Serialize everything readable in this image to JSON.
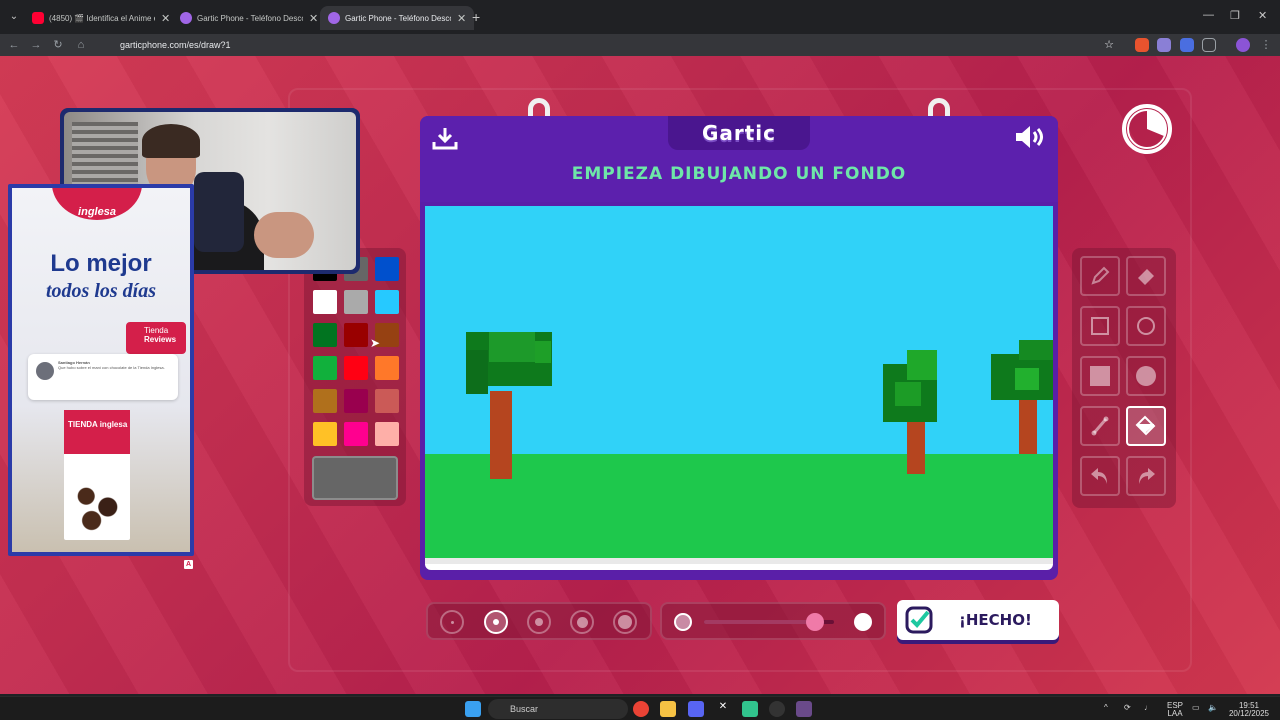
{
  "browser": {
    "tabs": [
      {
        "label": "(4850) 🎬 Identifica el Anime e",
        "favicon": "youtube-icon"
      },
      {
        "label": "Gartic Phone - Teléfono Desco",
        "favicon": "gartic-icon"
      },
      {
        "label": "Gartic Phone - Teléfono Desco",
        "favicon": "gartic-icon",
        "active": true
      }
    ],
    "url": "garticphone.com/es/draw?1"
  },
  "game": {
    "logo": "Gartic",
    "instruction": "EMPIEZA DIBUJANDO UN FONDO",
    "done_label": "¡HECHO!",
    "palette": [
      "#000000",
      "#666666",
      "#0050cd",
      "#ffffff",
      "#aaaaaa",
      "#26c9ff",
      "#017420",
      "#990000",
      "#964112",
      "#11b03c",
      "#ff0013",
      "#ff7829",
      "#b0701c",
      "#99004e",
      "#cb5a57",
      "#ffc126",
      "#ff008f",
      "#feafa8"
    ],
    "current_color": "#666666",
    "selected_tool": "fill",
    "selected_brush_size": 2,
    "brush_sizes": 5,
    "opacity_level": 0.85
  },
  "ad": {
    "headline": "Lo mejor",
    "subline": "todos los días",
    "badge_line1": "Tienda",
    "badge_line2": "Reviews",
    "brand": "inglesa",
    "box_text": "TIENDA inglesa",
    "review_name": "Santiago Hernán",
    "review_text": "Que hubo sobre el maní con chocolate de la Tienda Inglesa.",
    "marker": "A"
  },
  "taskbar": {
    "search_label": "Buscar",
    "lang_line1": "ESP",
    "lang_line2": "LAA",
    "time": "19:51",
    "date": "20/12/2025"
  }
}
